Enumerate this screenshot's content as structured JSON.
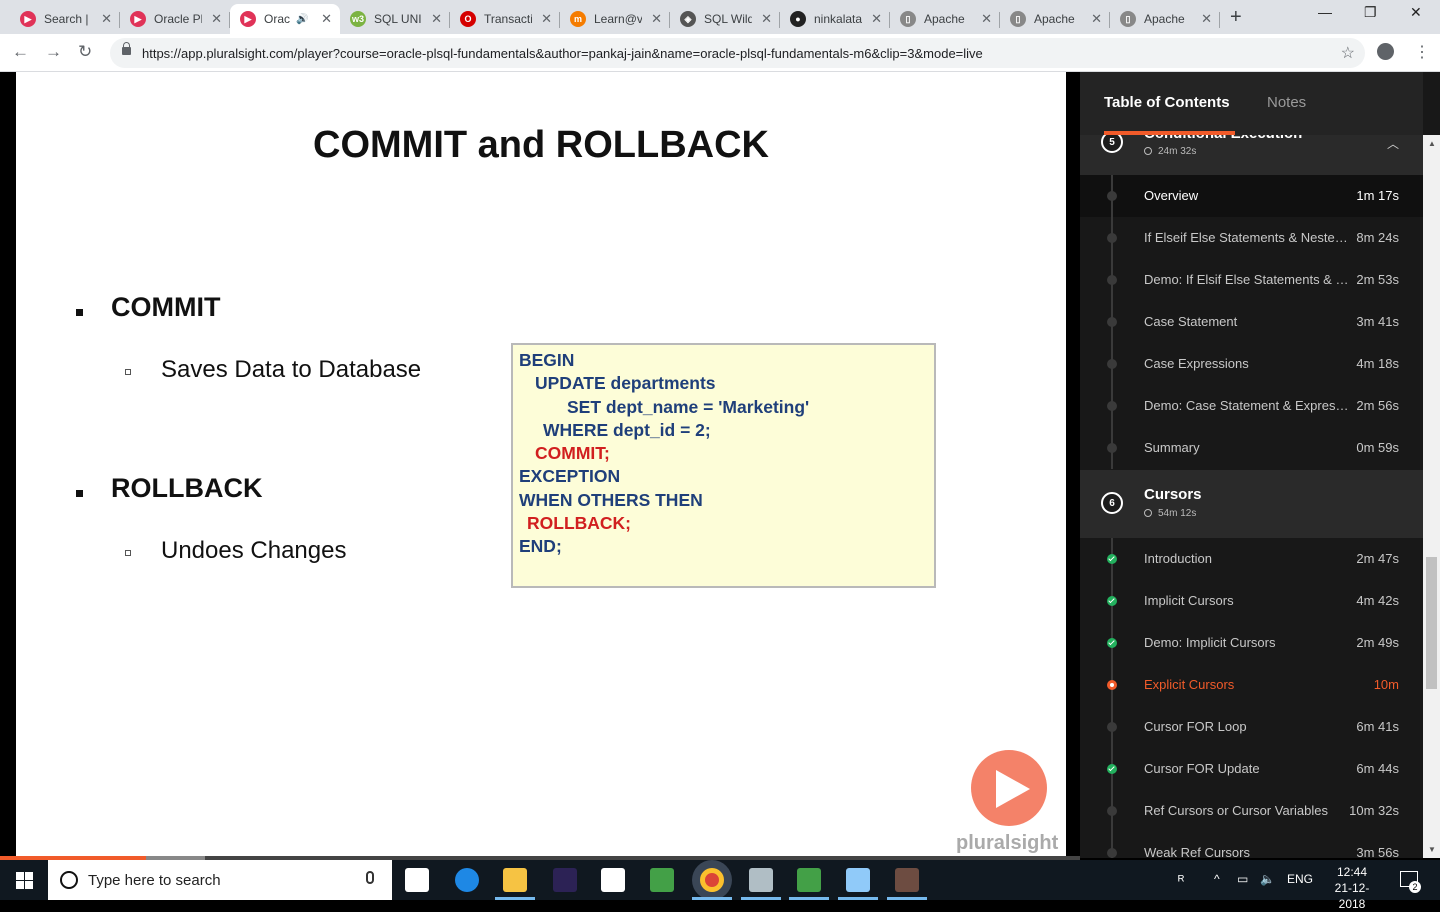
{
  "browser": {
    "tabs": [
      {
        "title": "Search |",
        "color": "#e03358",
        "glyph": "▶"
      },
      {
        "title": "Oracle Pl",
        "color": "#e03358",
        "glyph": "▶"
      },
      {
        "title": "Orac",
        "color": "#e03358",
        "glyph": "▶",
        "active": true,
        "audio": "🔊"
      },
      {
        "title": "SQL UNI",
        "color": "#7cb342",
        "glyph": "w3"
      },
      {
        "title": "Transacti",
        "color": "#d50000",
        "glyph": "O"
      },
      {
        "title": "Learn@v",
        "color": "#f57c00",
        "glyph": "m"
      },
      {
        "title": "SQL Wild",
        "color": "#555555",
        "glyph": "◈"
      },
      {
        "title": "ninkalata",
        "color": "#222222",
        "glyph": "●"
      },
      {
        "title": "Apache",
        "color": "#888888",
        "glyph": "▯"
      },
      {
        "title": "Apache",
        "color": "#888888",
        "glyph": "▯"
      },
      {
        "title": "Apache",
        "color": "#888888",
        "glyph": "▯"
      }
    ],
    "new_tab": "+",
    "minimize": "—",
    "maximize": "❐",
    "close": "✕",
    "back": "←",
    "forward": "→",
    "reload": "↻",
    "url": "https://app.pluralsight.com/player?course=oracle-plsql-fundamentals&author=pankaj-jain&name=oracle-plsql-fundamentals-m6&clip=3&mode=live",
    "bookmark_star": "☆",
    "menu_icon": "⋮"
  },
  "slide": {
    "title": "COMMIT and ROLLBACK",
    "items": [
      {
        "heading": "COMMIT",
        "sub": "Saves Data to Database"
      },
      {
        "heading": "ROLLBACK",
        "sub": "Undoes Changes"
      }
    ],
    "code": [
      {
        "text": "BEGIN",
        "indent": 0,
        "red": false
      },
      {
        "text": "UPDATE departments",
        "indent": 2,
        "red": false
      },
      {
        "text": "SET dept_name = 'Marketing'",
        "indent": 6,
        "red": false
      },
      {
        "text": "WHERE dept_id = 2;",
        "indent": 3,
        "red": false
      },
      {
        "text": "COMMIT;",
        "indent": 2,
        "red": true
      },
      {
        "text": "EXCEPTION",
        "indent": 0,
        "red": false
      },
      {
        "text": "WHEN OTHERS THEN",
        "indent": 0,
        "red": false
      },
      {
        "text": "ROLLBACK;",
        "indent": 1,
        "red": true
      },
      {
        "text": "END;",
        "indent": 0,
        "red": false
      }
    ],
    "watermark": "pluralsight"
  },
  "player": {
    "progress": 0.135,
    "buffered_start": 0.135,
    "buffered_end": 0.19
  },
  "sidebar": {
    "tab_toc": "Table of Contents",
    "tab_notes": "Notes",
    "module5": {
      "num": "5",
      "title": "Conditional Execution",
      "duration": "24m 32s"
    },
    "module5_clips": [
      {
        "title": "Overview",
        "time": "1m 17s",
        "state": "selected"
      },
      {
        "title": "If Elseif Else Statements & Nested If",
        "time": "8m 24s",
        "state": ""
      },
      {
        "title": "Demo: If Elsif Else Statements & Nested If",
        "time": "2m 53s",
        "state": ""
      },
      {
        "title": "Case Statement",
        "time": "3m 41s",
        "state": ""
      },
      {
        "title": "Case Expressions",
        "time": "4m 18s",
        "state": ""
      },
      {
        "title": "Demo: Case Statement & Expressions",
        "time": "2m 56s",
        "state": ""
      },
      {
        "title": "Summary",
        "time": "0m 59s",
        "state": ""
      }
    ],
    "module6": {
      "num": "6",
      "title": "Cursors",
      "duration": "54m 12s"
    },
    "module6_clips": [
      {
        "title": "Introduction",
        "time": "2m 47s",
        "state": "done"
      },
      {
        "title": "Implicit Cursors",
        "time": "4m 42s",
        "state": "done"
      },
      {
        "title": "Demo: Implicit Cursors",
        "time": "2m 49s",
        "state": "done"
      },
      {
        "title": "Explicit Cursors",
        "time": "10m",
        "state": "playing"
      },
      {
        "title": "Cursor FOR Loop",
        "time": "6m 41s",
        "state": ""
      },
      {
        "title": "Cursor FOR Update",
        "time": "6m 44s",
        "state": "done"
      },
      {
        "title": "Ref Cursors or Cursor Variables",
        "time": "10m 32s",
        "state": ""
      },
      {
        "title": "Weak Ref Cursors",
        "time": "3m 56s",
        "state": ""
      }
    ]
  },
  "taskbar": {
    "search_placeholder": "Type here to search",
    "apps": [
      {
        "name": "task-view-icon",
        "color": "#ffffff"
      },
      {
        "name": "edge-icon",
        "color": "#1e88e5"
      },
      {
        "name": "file-explorer-icon",
        "color": "#f6c343"
      },
      {
        "name": "eclipse-icon",
        "color": "#2c2255"
      },
      {
        "name": "mail-icon",
        "color": "#ffffff"
      },
      {
        "name": "media-icon",
        "color": "#43a047"
      },
      {
        "name": "chrome-icon",
        "color": "#db4437",
        "active": true
      },
      {
        "name": "notepad-icon",
        "color": "#b0bec5"
      },
      {
        "name": "media-player-icon",
        "color": "#43a047"
      },
      {
        "name": "sql-developer-icon",
        "color": "#90caf9"
      },
      {
        "name": "app-icon",
        "color": "#6d4c41"
      }
    ],
    "tray_person": "ᴿ",
    "tray_chevron": "^",
    "tray_network": "▭",
    "tray_volume": "🔈",
    "language": "ENG",
    "time": "12:44",
    "date": "21-12-2018",
    "notifications": "2"
  }
}
